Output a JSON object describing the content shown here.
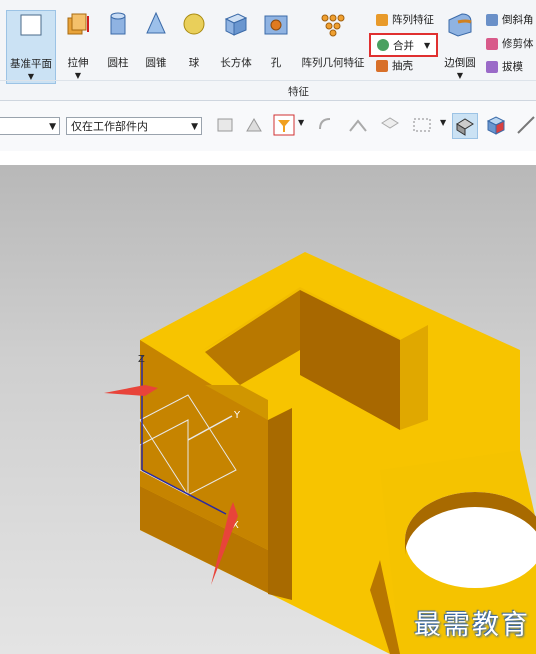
{
  "ribbon": {
    "tools": [
      {
        "name": "datum-plane",
        "label": "基准平面"
      },
      {
        "name": "extrude",
        "label": "拉伸"
      },
      {
        "name": "cylinder",
        "label": "圆柱"
      },
      {
        "name": "cone",
        "label": "圆锥"
      },
      {
        "name": "sphere",
        "label": "球"
      },
      {
        "name": "block",
        "label": "长方体"
      },
      {
        "name": "hole",
        "label": "孔"
      },
      {
        "name": "pattern-geometry",
        "label": "阵列几何特征"
      },
      {
        "name": "edge-blend",
        "label": "边倒圆"
      }
    ],
    "small": {
      "pattern_feature": "阵列特征",
      "unite": "合并",
      "shell": "抽壳",
      "chamfer": "倒斜角",
      "trim_body": "修剪体",
      "draft": "拔模"
    },
    "group_label": "特征"
  },
  "filterbar": {
    "type_filter_value": "",
    "scope_value": "仅在工作部件内"
  },
  "viewport": {
    "axis_labels": {
      "x": "X",
      "y": "Y",
      "z": "Z"
    },
    "watermark": "最需教育"
  },
  "colors": {
    "part": "#f5c200",
    "part_dark": "#b87b00",
    "highlight": "#e03030",
    "arrow": "#e8443a"
  }
}
